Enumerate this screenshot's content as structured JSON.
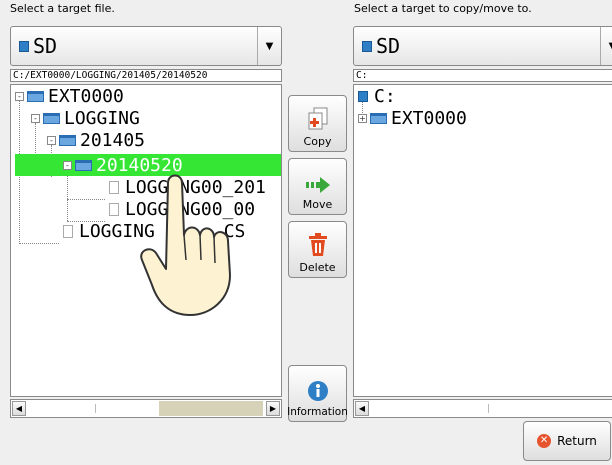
{
  "left_panel": {
    "label": "Select a target file.",
    "drive": "SD",
    "path": "C:/EXT0000/LOGGING/201405/20140520",
    "tree": [
      {
        "text": "EXT0000",
        "kind": "folder",
        "expander": "-"
      },
      {
        "text": "LOGGING",
        "kind": "folder",
        "expander": "-"
      },
      {
        "text": "201405",
        "kind": "folder",
        "expander": "-"
      },
      {
        "text": "20140520",
        "kind": "folder",
        "expander": "-",
        "selected": true
      },
      {
        "text": "LOGGING00_201",
        "kind": "file"
      },
      {
        "text": "LOGGING00_00",
        "kind": "file"
      },
      {
        "text": "LOGGING",
        "kind": "file",
        "suffix": ".CS"
      }
    ]
  },
  "right_panel": {
    "label": "Select a target to copy/move to.",
    "drive": "SD",
    "path": "C:",
    "tree": [
      {
        "text": "C:",
        "kind": "drive"
      },
      {
        "text": "EXT0000",
        "kind": "folder",
        "expander": "+"
      }
    ]
  },
  "actions": {
    "copy": "Copy",
    "move": "Move",
    "delete": "Delete",
    "information": "Information"
  },
  "footer": {
    "return": "Return"
  },
  "colors": {
    "selection": "#35e635",
    "folder": "#6aa7e0",
    "move_arrow": "#3aa83a",
    "delete_icon": "#e24b1f",
    "info_icon": "#2f7fc6"
  }
}
